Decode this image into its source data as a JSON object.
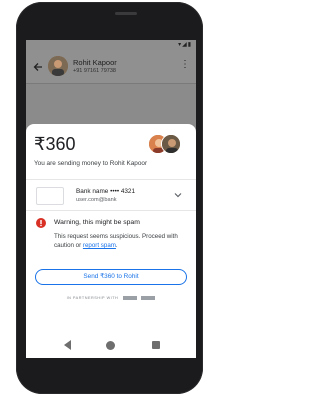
{
  "status_bar": {
    "icons": "▾◢▮"
  },
  "app_bar": {
    "back_icon": "arrow-back-icon",
    "contact_name": "Rohit Kapoor",
    "contact_phone": "+91 97161 79738",
    "more_icon": "⋮"
  },
  "payment_sheet": {
    "amount": "₹360",
    "sending_text": "You are sending money to Rohit Kapoor",
    "bank": {
      "name": "Bank name •••• 4321",
      "upi_id": "user.com@bank"
    },
    "warning": {
      "title": "Warning, this might be spam",
      "body_prefix": "This request seems suspicious. Proceed with caution or ",
      "link_text": "report spam",
      "body_suffix": "."
    },
    "send_button": "Send ₹360 to Rohit",
    "partner_text": "IN PARTNERSHIP WITH"
  },
  "colors": {
    "accent": "#1a73e8",
    "warning": "#d93025",
    "dim_overlay": "#8b8b8b"
  }
}
